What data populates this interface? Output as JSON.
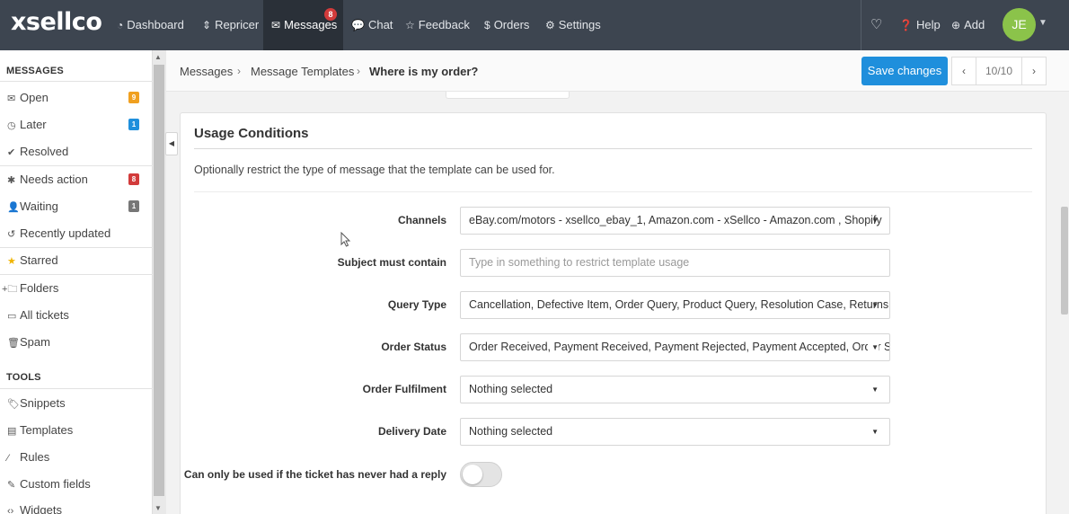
{
  "app": {
    "logo": "xsellco"
  },
  "nav": {
    "items": [
      {
        "label": "Dashboard",
        "icon": "dashboard-icon"
      },
      {
        "label": "Repricer",
        "icon": "repricer-icon"
      },
      {
        "label": "Messages",
        "icon": "envelope-icon",
        "badge": "8",
        "active": true
      },
      {
        "label": "Chat",
        "icon": "chat-icon"
      },
      {
        "label": "Feedback",
        "icon": "star-icon"
      },
      {
        "label": "Orders",
        "icon": "dollar-icon"
      },
      {
        "label": "Settings",
        "icon": "gear-icon"
      }
    ],
    "help": "Help",
    "add": "Add",
    "avatar_initials": "JE"
  },
  "sidebar": {
    "messages_heading": "MESSAGES",
    "items": [
      {
        "label": "Open",
        "badge": "9",
        "badge_color": "#f0a020"
      },
      {
        "label": "Later",
        "badge": "1",
        "badge_color": "#1f8fdc"
      },
      {
        "label": "Resolved"
      },
      {
        "label": "Needs action",
        "badge": "8",
        "badge_color": "#d23b3b"
      },
      {
        "label": "Waiting",
        "badge": "1",
        "badge_color": "#777777"
      },
      {
        "label": "Recently updated"
      },
      {
        "label": "Starred"
      },
      {
        "label": "Folders"
      },
      {
        "label": "All tickets"
      },
      {
        "label": "Spam"
      }
    ],
    "tools_heading": "TOOLS",
    "tools": [
      {
        "label": "Snippets"
      },
      {
        "label": "Templates"
      },
      {
        "label": "Rules"
      },
      {
        "label": "Custom fields"
      },
      {
        "label": "Widgets"
      }
    ]
  },
  "breadcrumb": {
    "items": [
      "Messages",
      "Message Templates",
      "Where is my order?"
    ]
  },
  "toolbar": {
    "save_label": "Save changes",
    "pager": "10/10"
  },
  "panel": {
    "title": "Usage Conditions",
    "description": "Optionally restrict the type of message that the template can be used for.",
    "fields": [
      {
        "label": "Channels",
        "value": "eBay.com/motors - xsellco_ebay_1, Amazon.com - xSellco - Amazon.com , Shopify",
        "type": "select"
      },
      {
        "label": "Subject must contain",
        "placeholder": "Type in something to restrict template usage",
        "type": "input"
      },
      {
        "label": "Query Type",
        "value": "Cancellation, Defective Item, Order Query, Product Query, Resolution Case, Returns",
        "type": "select"
      },
      {
        "label": "Order Status",
        "value": "Order Received, Payment Received, Payment Rejected, Payment Accepted, Order Shipped",
        "type": "select"
      },
      {
        "label": "Order Fulfilment",
        "value": "Nothing selected",
        "type": "select"
      },
      {
        "label": "Delivery Date",
        "value": "Nothing selected",
        "type": "select"
      }
    ],
    "toggle_label": "Can only be used if the ticket has never had a reply",
    "toggle_on": false
  },
  "colors": {
    "accent": "#1f8fdc",
    "nav_bg": "#3d4550",
    "avatar": "#8bc34a"
  }
}
